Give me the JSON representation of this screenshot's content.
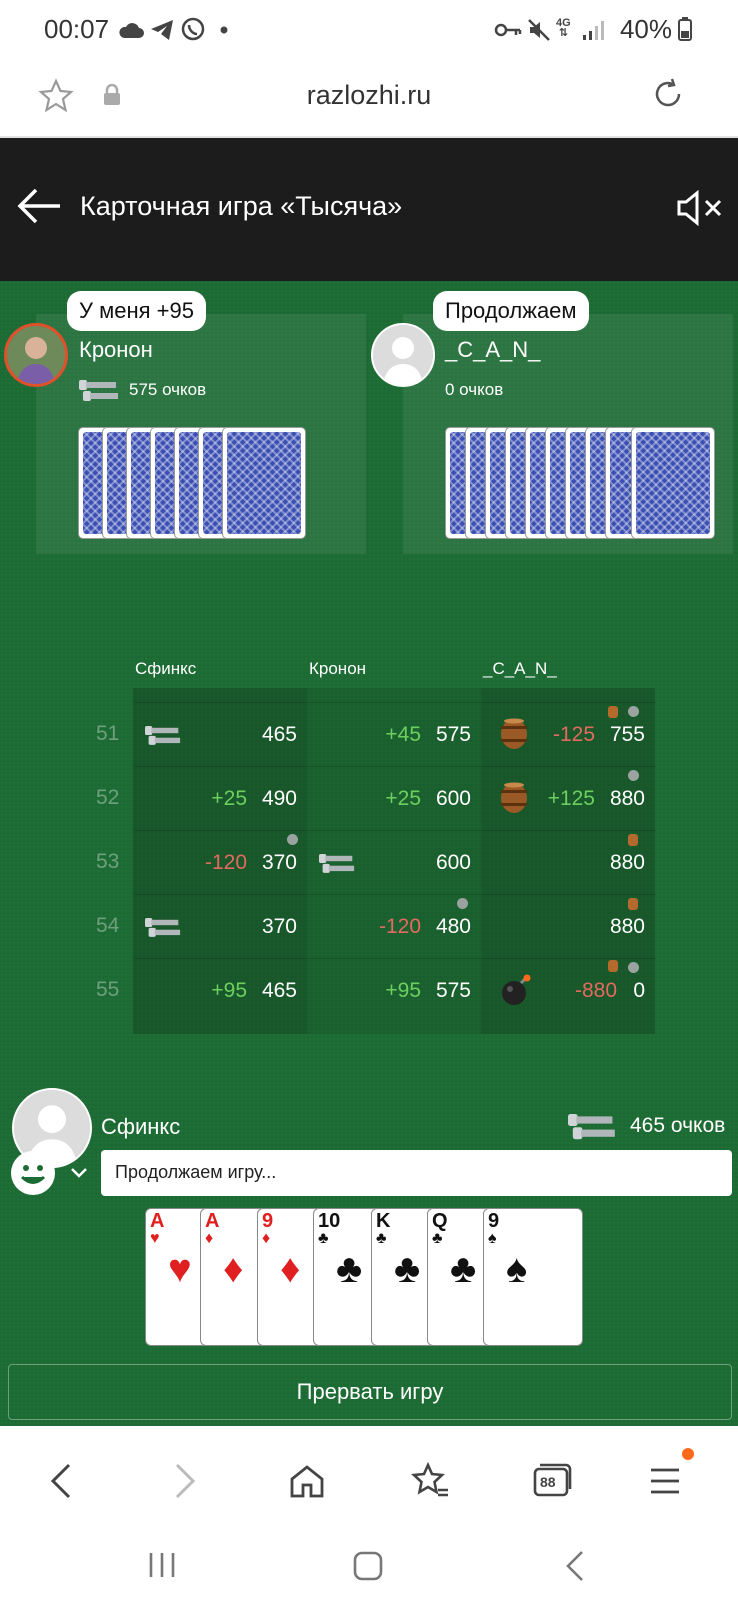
{
  "status_bar": {
    "time": "00:07",
    "battery": "40%",
    "network": "4G"
  },
  "browser": {
    "url": "razlozhi.ru"
  },
  "app": {
    "title": "Карточная игра «Тысяча»"
  },
  "players": {
    "left": {
      "name": "Кронон",
      "score": "575 очков",
      "bubble": "У меня +95",
      "cards": 7
    },
    "right": {
      "name": "_C_A_N_",
      "score": "0 очков",
      "bubble": "Продолжаем",
      "cards": 10
    },
    "me": {
      "name": "Сфинкс",
      "score": "465 очков",
      "message": "Продолжаем игру..."
    }
  },
  "scoreboard": {
    "columns": [
      "Сфинкс",
      "Кронон",
      "_C_A_N_"
    ],
    "rows": [
      {
        "num": "51",
        "cells": [
          {
            "icon": "bolt",
            "delta": "",
            "total": "465"
          },
          {
            "icon": "",
            "delta": "+45",
            "total": "575"
          },
          {
            "icon": "barrel",
            "delta": "-125",
            "total": "755"
          }
        ]
      },
      {
        "num": "52",
        "cells": [
          {
            "icon": "",
            "delta": "+25",
            "total": "490"
          },
          {
            "icon": "",
            "delta": "+25",
            "total": "600"
          },
          {
            "icon": "barrel",
            "delta": "+125",
            "total": "880"
          }
        ]
      },
      {
        "num": "53",
        "cells": [
          {
            "icon": "",
            "delta": "-120",
            "total": "370"
          },
          {
            "icon": "bolt",
            "delta": "",
            "total": "600"
          },
          {
            "icon": "",
            "delta": "",
            "total": "880"
          }
        ]
      },
      {
        "num": "54",
        "cells": [
          {
            "icon": "bolt",
            "delta": "",
            "total": "370"
          },
          {
            "icon": "",
            "delta": "-120",
            "total": "480"
          },
          {
            "icon": "",
            "delta": "",
            "total": "880"
          }
        ]
      },
      {
        "num": "55",
        "cells": [
          {
            "icon": "",
            "delta": "+95",
            "total": "465"
          },
          {
            "icon": "",
            "delta": "+95",
            "total": "575"
          },
          {
            "icon": "bomb",
            "delta": "-880",
            "total": "0"
          }
        ]
      }
    ]
  },
  "hand": [
    {
      "rank": "A",
      "suit": "♥",
      "color": "red"
    },
    {
      "rank": "A",
      "suit": "♦",
      "color": "red"
    },
    {
      "rank": "9",
      "suit": "♦",
      "color": "red"
    },
    {
      "rank": "10",
      "suit": "♣",
      "color": "black"
    },
    {
      "rank": "K",
      "suit": "♣",
      "color": "black"
    },
    {
      "rank": "Q",
      "suit": "♣",
      "color": "black"
    },
    {
      "rank": "9",
      "suit": "♠",
      "color": "black"
    }
  ],
  "actions": {
    "stop_game": "Прервать игру"
  },
  "browser_nav": {
    "tabs_count": "88"
  },
  "colors": {
    "table_green": "#1d6b34",
    "header": "#1c1c1c",
    "positive": "#6cd05f",
    "negative": "#e26a5e"
  }
}
